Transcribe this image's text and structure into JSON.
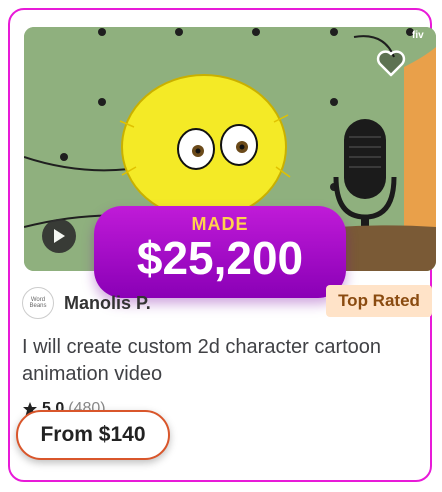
{
  "gig": {
    "badge_top": "MADE",
    "badge_amount": "$25,200",
    "seller_name": "Manolis P.",
    "avatar_text": "Word Beans",
    "seller_level": "Top Rated",
    "title": "I will create custom 2d character cartoon animation video",
    "rating_value": "5.0",
    "rating_count": "(480)",
    "price": "From $140",
    "thumbnail_watermark": "fiv"
  },
  "icons": {
    "favorite": "heart-icon",
    "play": "play-icon",
    "rating": "star-icon"
  },
  "colors": {
    "card_border": "#e81ad8",
    "badge_gradient_top": "#c01bd8",
    "badge_gradient_bottom": "#8a00b6",
    "badge_label": "#ffd34d",
    "level_bg": "#ffe3c8",
    "price_border": "#d9562b"
  }
}
